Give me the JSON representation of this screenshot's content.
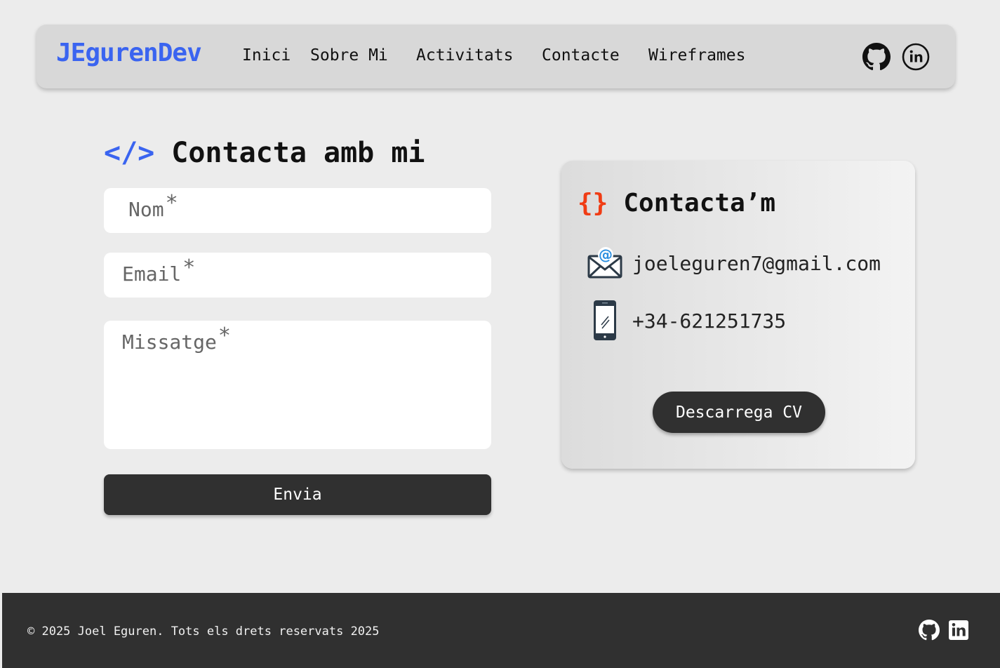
{
  "nav": {
    "brand": "JEgurenDev",
    "links": [
      "Inici",
      "Sobre Mi",
      "Activitats",
      "Contacte",
      "Wireframes"
    ],
    "icons": [
      "github-icon",
      "linkedin-icon"
    ],
    "brand_color": "#3a64f0"
  },
  "form": {
    "title_glyph": "</>",
    "title": "Contacta amb mi",
    "name_placeholder": "Nom",
    "email_placeholder": "Email",
    "message_placeholder": "Missatge",
    "required_mark": "*",
    "submit_label": "Envia"
  },
  "card": {
    "title_glyph": "{}",
    "title": "Contacta’m",
    "email": "joeleguren7@gmail.com",
    "phone": "+34-621251735",
    "cv_button": "Descarrega CV",
    "accent_color": "#f03c14"
  },
  "footer": {
    "copyright": "© 2025 Joel Eguren. Tots els drets reservats 2025",
    "icons": [
      "github-icon",
      "linkedin-icon"
    ],
    "background": "#303030"
  }
}
